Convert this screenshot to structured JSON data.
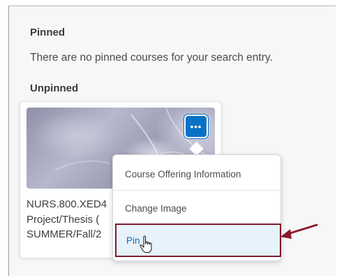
{
  "pinned": {
    "heading": "Pinned",
    "empty_message": "There are no pinned courses for your search entry."
  },
  "unpinned": {
    "heading": "Unpinned"
  },
  "course_card": {
    "title_lines": [
      "NURS.800.XED4",
      "Project/Thesis (",
      "SUMMER/Fall/2"
    ],
    "more_button_label": "•••"
  },
  "context_menu": {
    "items": [
      {
        "label": "Course Offering Information"
      },
      {
        "label": "Change Image"
      },
      {
        "label": "Pin"
      }
    ],
    "selected_index": 2
  },
  "colors": {
    "accent": "#0a72c4",
    "highlight_border": "#7c1b2c",
    "annotation_arrow": "#8b1a2b"
  }
}
